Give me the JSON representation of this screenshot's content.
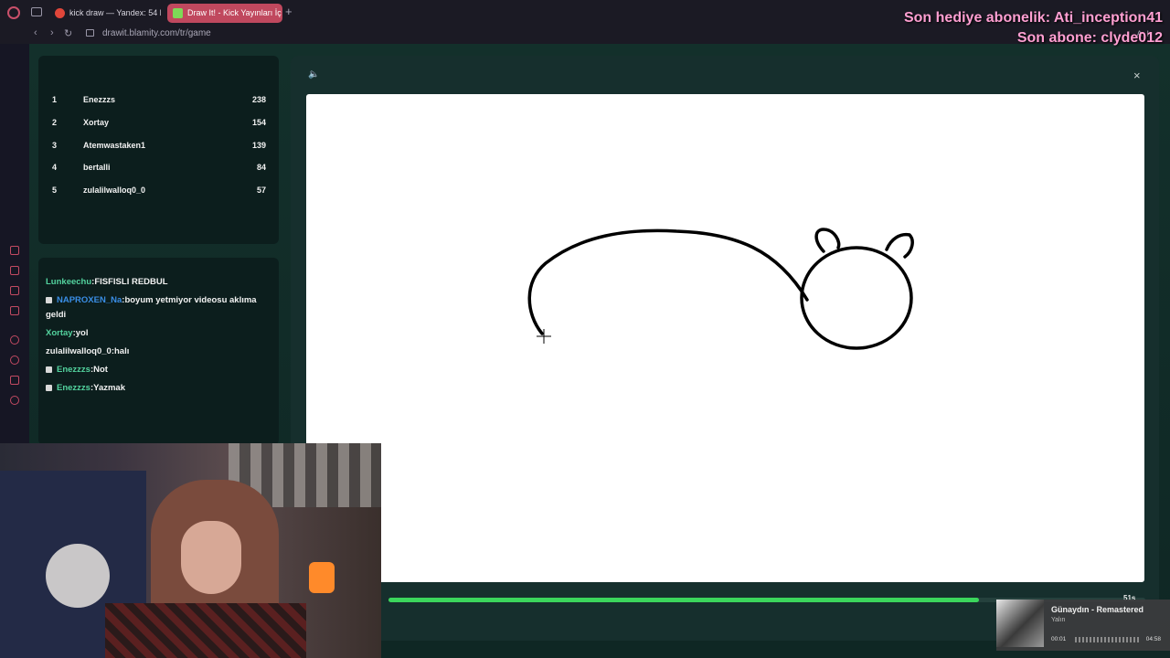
{
  "browser": {
    "tabs": [
      {
        "label": "kick draw — Yandex: 54 b"
      },
      {
        "label": "Draw It! - Kick Yayınları İç"
      }
    ],
    "new_tab": "+",
    "url": "drawit.blamity.com/tr/game",
    "nav": {
      "back": "‹",
      "forward": "›",
      "reload": "↻"
    },
    "ai_label": "AI"
  },
  "leaderboard": [
    {
      "rank": "1",
      "name": "Enezzzs",
      "score": "238"
    },
    {
      "rank": "2",
      "name": "Xortay",
      "score": "154"
    },
    {
      "rank": "3",
      "name": "Atemwastaken1",
      "score": "139"
    },
    {
      "rank": "4",
      "name": "bertalli",
      "score": "84"
    },
    {
      "rank": "5",
      "name": "zulalilwalloq0_0",
      "score": "57"
    }
  ],
  "chat": [
    {
      "user": "Lunkeechu",
      "message": "FISFISLI REDBUL",
      "badge": false
    },
    {
      "user": "NAPROXEN_Na",
      "message": "boyum yetmiyor videosu aklıma geldi",
      "badge": true
    },
    {
      "user": "Xortay",
      "message": "yol",
      "badge": false
    },
    {
      "user": "zulalilwalloq0_0",
      "message": "halı",
      "badge": false
    },
    {
      "user": "Enezzzs",
      "message": "Not",
      "badge": true
    },
    {
      "user": "Enezzzs",
      "message": "Yazmak",
      "badge": true
    }
  ],
  "game": {
    "sound_icon": "speaker-icon",
    "close_label": "×",
    "timer_label": "51s",
    "timer_progress": 0.78
  },
  "stream_overlay": {
    "line1": "Son hediye abonelik: Ati_inception41",
    "line2": "Son abone: clyde012"
  },
  "music": {
    "title": "Günaydın - Remastered",
    "artist": "Yalın",
    "elapsed": "00:01",
    "duration": "04:58"
  },
  "colors": {
    "accent_green": "#3bd65c",
    "overlay_pink": "#ff9fd2",
    "tab_active": "#c0485e"
  }
}
